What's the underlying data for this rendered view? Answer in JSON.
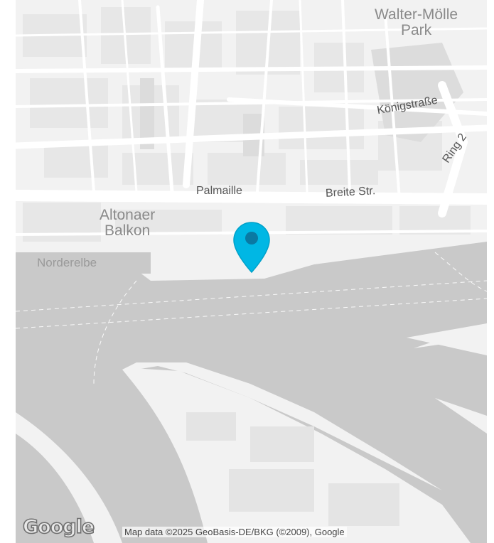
{
  "map": {
    "labels": {
      "park": "Walter-Mölle\nPark",
      "park_line1": "Walter-Mölle",
      "park_line2": "Park",
      "koenigstrasse": "Königstraße",
      "ring2": "Ring 2",
      "palmaille": "Palmaille",
      "breite_str": "Breite Str.",
      "altonaer_line1": "Altonaer",
      "altonaer_line2": "Balkon",
      "norderelbe": "Norderelbe"
    },
    "marker": {
      "color": "#00b7e4",
      "dot_color": "#0a79a3"
    },
    "colors": {
      "land": "#f2f2f2",
      "water": "#c9c9c9",
      "road": "#ffffff",
      "block": "#e6e6e6"
    }
  },
  "footer": {
    "logo": "Google",
    "attribution": "Map data ©2025 GeoBasis-DE/BKG (©2009), Google"
  }
}
